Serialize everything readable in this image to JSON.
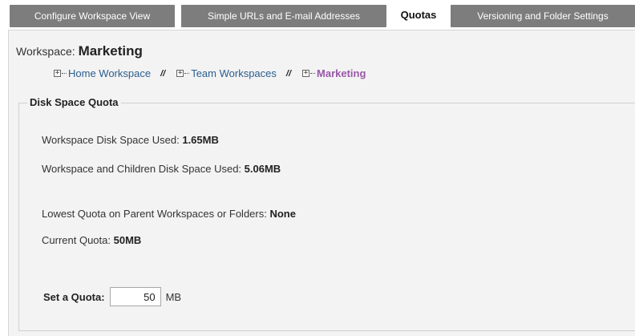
{
  "tabs": [
    {
      "label": "Configure Workspace View"
    },
    {
      "label": "Simple URLs and E-mail Addresses"
    },
    {
      "label": "Quotas"
    },
    {
      "label": "Versioning and Folder Settings"
    }
  ],
  "workspace": {
    "prefix": "Workspace:",
    "name": "Marketing"
  },
  "breadcrumb": {
    "items": [
      {
        "label": "Home Workspace"
      },
      {
        "label": "Team Workspaces"
      },
      {
        "label": "Marketing"
      }
    ],
    "separator": "//"
  },
  "quota": {
    "legend": "Disk Space Quota",
    "used_label": "Workspace Disk Space Used:",
    "used_value": "1.65MB",
    "children_label": "Workspace and Children Disk Space Used:",
    "children_value": "5.06MB",
    "lowest_label": "Lowest Quota on Parent Workspaces or Folders:",
    "lowest_value": "None",
    "current_label": "Current Quota:",
    "current_value": "50MB",
    "set_label": "Set a Quota:",
    "set_value": "50",
    "unit": "MB"
  }
}
